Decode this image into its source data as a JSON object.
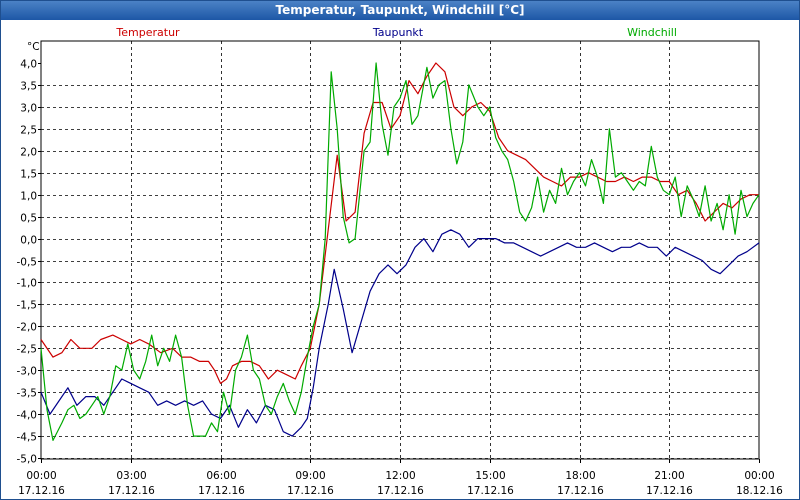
{
  "window": {
    "title": "Temperatur, Taupunkt, Windchill [°C]"
  },
  "chart_data": {
    "type": "line",
    "title": "Temperatur, Taupunkt, Windchill [°C]",
    "ylabel": "°C",
    "ylim": [
      -5.0,
      4.0
    ],
    "y_ticks": [
      "4,0",
      "3,5",
      "3,0",
      "2,5",
      "2,0",
      "1,5",
      "1,0",
      "0,5",
      "0,0",
      "-0,5",
      "-1,0",
      "-1,5",
      "-2,0",
      "-2,5",
      "-3,0",
      "-3,5",
      "-4,0",
      "-4,5",
      "-5,0"
    ],
    "x_range_hours": [
      0,
      24
    ],
    "x_ticks": [
      {
        "time": "00:00",
        "date": "17.12.16"
      },
      {
        "time": "03:00",
        "date": "17.12.16"
      },
      {
        "time": "06:00",
        "date": "17.12.16"
      },
      {
        "time": "09:00",
        "date": "17.12.16"
      },
      {
        "time": "12:00",
        "date": "17.12.16"
      },
      {
        "time": "15:00",
        "date": "17.12.16"
      },
      {
        "time": "18:00",
        "date": "17.12.16"
      },
      {
        "time": "21:00",
        "date": "17.12.16"
      },
      {
        "time": "00:00",
        "date": "18.12.16"
      }
    ],
    "grid": true,
    "legend_position": "top",
    "series": [
      {
        "name": "Temperatur",
        "color": "#cc0000",
        "points": [
          [
            0.0,
            -2.3
          ],
          [
            0.4,
            -2.7
          ],
          [
            0.7,
            -2.6
          ],
          [
            1.0,
            -2.3
          ],
          [
            1.3,
            -2.5
          ],
          [
            1.7,
            -2.5
          ],
          [
            2.0,
            -2.3
          ],
          [
            2.4,
            -2.2
          ],
          [
            2.7,
            -2.3
          ],
          [
            3.0,
            -2.4
          ],
          [
            3.3,
            -2.3
          ],
          [
            3.6,
            -2.4
          ],
          [
            4.0,
            -2.6
          ],
          [
            4.4,
            -2.5
          ],
          [
            4.7,
            -2.7
          ],
          [
            5.0,
            -2.7
          ],
          [
            5.3,
            -2.8
          ],
          [
            5.6,
            -2.8
          ],
          [
            5.8,
            -3.0
          ],
          [
            6.0,
            -3.3
          ],
          [
            6.2,
            -3.2
          ],
          [
            6.4,
            -2.9
          ],
          [
            6.7,
            -2.8
          ],
          [
            7.0,
            -2.8
          ],
          [
            7.3,
            -2.9
          ],
          [
            7.6,
            -3.2
          ],
          [
            7.9,
            -3.0
          ],
          [
            8.2,
            -3.1
          ],
          [
            8.5,
            -3.2
          ],
          [
            8.7,
            -2.9
          ],
          [
            9.0,
            -2.5
          ],
          [
            9.3,
            -1.5
          ],
          [
            9.6,
            0.2
          ],
          [
            9.9,
            1.9
          ],
          [
            10.2,
            0.4
          ],
          [
            10.5,
            0.6
          ],
          [
            10.8,
            2.4
          ],
          [
            11.1,
            3.1
          ],
          [
            11.4,
            3.1
          ],
          [
            11.7,
            2.5
          ],
          [
            12.0,
            2.8
          ],
          [
            12.3,
            3.6
          ],
          [
            12.6,
            3.3
          ],
          [
            12.9,
            3.7
          ],
          [
            13.2,
            4.0
          ],
          [
            13.5,
            3.8
          ],
          [
            13.8,
            3.0
          ],
          [
            14.1,
            2.8
          ],
          [
            14.4,
            3.0
          ],
          [
            14.7,
            3.1
          ],
          [
            15.0,
            2.9
          ],
          [
            15.3,
            2.3
          ],
          [
            15.6,
            2.0
          ],
          [
            15.9,
            1.9
          ],
          [
            16.2,
            1.8
          ],
          [
            16.5,
            1.6
          ],
          [
            16.8,
            1.4
          ],
          [
            17.1,
            1.3
          ],
          [
            17.4,
            1.2
          ],
          [
            17.7,
            1.4
          ],
          [
            18.0,
            1.4
          ],
          [
            18.3,
            1.5
          ],
          [
            18.6,
            1.4
          ],
          [
            18.9,
            1.3
          ],
          [
            19.2,
            1.3
          ],
          [
            19.5,
            1.4
          ],
          [
            19.8,
            1.3
          ],
          [
            20.1,
            1.4
          ],
          [
            20.4,
            1.4
          ],
          [
            20.7,
            1.3
          ],
          [
            21.0,
            1.3
          ],
          [
            21.3,
            1.0
          ],
          [
            21.6,
            1.1
          ],
          [
            21.9,
            0.8
          ],
          [
            22.2,
            0.4
          ],
          [
            22.5,
            0.6
          ],
          [
            22.8,
            0.8
          ],
          [
            23.1,
            0.7
          ],
          [
            23.4,
            0.9
          ],
          [
            23.7,
            1.0
          ],
          [
            24.0,
            1.0
          ]
        ]
      },
      {
        "name": "Taupunkt",
        "color": "#00008b",
        "points": [
          [
            0.0,
            -3.5
          ],
          [
            0.3,
            -4.0
          ],
          [
            0.6,
            -3.7
          ],
          [
            0.9,
            -3.4
          ],
          [
            1.2,
            -3.8
          ],
          [
            1.5,
            -3.6
          ],
          [
            1.8,
            -3.6
          ],
          [
            2.1,
            -3.8
          ],
          [
            2.4,
            -3.5
          ],
          [
            2.7,
            -3.2
          ],
          [
            3.0,
            -3.3
          ],
          [
            3.3,
            -3.4
          ],
          [
            3.6,
            -3.5
          ],
          [
            3.9,
            -3.8
          ],
          [
            4.2,
            -3.7
          ],
          [
            4.5,
            -3.8
          ],
          [
            4.8,
            -3.7
          ],
          [
            5.1,
            -3.8
          ],
          [
            5.4,
            -3.7
          ],
          [
            5.7,
            -4.0
          ],
          [
            6.0,
            -4.1
          ],
          [
            6.3,
            -3.8
          ],
          [
            6.6,
            -4.3
          ],
          [
            6.9,
            -3.9
          ],
          [
            7.2,
            -4.2
          ],
          [
            7.5,
            -3.8
          ],
          [
            7.8,
            -3.9
          ],
          [
            8.1,
            -4.4
          ],
          [
            8.4,
            -4.5
          ],
          [
            8.7,
            -4.3
          ],
          [
            8.9,
            -4.1
          ],
          [
            9.1,
            -3.4
          ],
          [
            9.3,
            -2.5
          ],
          [
            9.6,
            -1.5
          ],
          [
            9.8,
            -0.7
          ],
          [
            10.1,
            -1.6
          ],
          [
            10.4,
            -2.6
          ],
          [
            10.7,
            -1.9
          ],
          [
            11.0,
            -1.2
          ],
          [
            11.3,
            -0.8
          ],
          [
            11.6,
            -0.6
          ],
          [
            11.9,
            -0.8
          ],
          [
            12.2,
            -0.6
          ],
          [
            12.5,
            -0.2
          ],
          [
            12.8,
            0.0
          ],
          [
            13.1,
            -0.3
          ],
          [
            13.4,
            0.1
          ],
          [
            13.7,
            0.2
          ],
          [
            14.0,
            0.1
          ],
          [
            14.3,
            -0.2
          ],
          [
            14.6,
            0.0
          ],
          [
            14.9,
            0.0
          ],
          [
            15.2,
            0.0
          ],
          [
            15.5,
            -0.1
          ],
          [
            15.8,
            -0.1
          ],
          [
            16.1,
            -0.2
          ],
          [
            16.4,
            -0.3
          ],
          [
            16.7,
            -0.4
          ],
          [
            17.0,
            -0.3
          ],
          [
            17.3,
            -0.2
          ],
          [
            17.6,
            -0.1
          ],
          [
            17.9,
            -0.2
          ],
          [
            18.2,
            -0.2
          ],
          [
            18.5,
            -0.1
          ],
          [
            18.8,
            -0.2
          ],
          [
            19.1,
            -0.3
          ],
          [
            19.4,
            -0.2
          ],
          [
            19.7,
            -0.2
          ],
          [
            20.0,
            -0.1
          ],
          [
            20.3,
            -0.2
          ],
          [
            20.6,
            -0.2
          ],
          [
            20.9,
            -0.4
          ],
          [
            21.2,
            -0.2
          ],
          [
            21.5,
            -0.3
          ],
          [
            21.8,
            -0.4
          ],
          [
            22.1,
            -0.5
          ],
          [
            22.4,
            -0.7
          ],
          [
            22.7,
            -0.8
          ],
          [
            23.0,
            -0.6
          ],
          [
            23.3,
            -0.4
          ],
          [
            23.6,
            -0.3
          ],
          [
            24.0,
            -0.1
          ]
        ]
      },
      {
        "name": "Windchill",
        "color": "#00aa00",
        "points": [
          [
            0.0,
            -2.5
          ],
          [
            0.2,
            -3.9
          ],
          [
            0.4,
            -4.6
          ],
          [
            0.7,
            -4.2
          ],
          [
            0.9,
            -3.9
          ],
          [
            1.1,
            -3.8
          ],
          [
            1.3,
            -4.1
          ],
          [
            1.5,
            -4.0
          ],
          [
            1.7,
            -3.8
          ],
          [
            1.9,
            -3.6
          ],
          [
            2.1,
            -4.0
          ],
          [
            2.3,
            -3.6
          ],
          [
            2.5,
            -2.9
          ],
          [
            2.7,
            -3.0
          ],
          [
            2.9,
            -2.4
          ],
          [
            3.1,
            -3.0
          ],
          [
            3.3,
            -3.2
          ],
          [
            3.5,
            -2.8
          ],
          [
            3.7,
            -2.2
          ],
          [
            3.9,
            -2.9
          ],
          [
            4.1,
            -2.5
          ],
          [
            4.3,
            -2.8
          ],
          [
            4.5,
            -2.2
          ],
          [
            4.7,
            -2.7
          ],
          [
            4.9,
            -3.8
          ],
          [
            5.1,
            -4.5
          ],
          [
            5.3,
            -4.5
          ],
          [
            5.5,
            -4.5
          ],
          [
            5.7,
            -4.2
          ],
          [
            5.9,
            -4.4
          ],
          [
            6.1,
            -3.5
          ],
          [
            6.3,
            -4.0
          ],
          [
            6.5,
            -3.0
          ],
          [
            6.7,
            -2.7
          ],
          [
            6.9,
            -2.2
          ],
          [
            7.1,
            -3.0
          ],
          [
            7.3,
            -3.2
          ],
          [
            7.5,
            -3.8
          ],
          [
            7.7,
            -4.0
          ],
          [
            7.9,
            -3.6
          ],
          [
            8.1,
            -3.3
          ],
          [
            8.3,
            -3.7
          ],
          [
            8.5,
            -4.0
          ],
          [
            8.7,
            -3.5
          ],
          [
            8.9,
            -2.7
          ],
          [
            9.1,
            -2.0
          ],
          [
            9.3,
            -1.5
          ],
          [
            9.5,
            0.0
          ],
          [
            9.7,
            3.8
          ],
          [
            9.9,
            2.5
          ],
          [
            10.1,
            0.5
          ],
          [
            10.3,
            -0.1
          ],
          [
            10.5,
            0.0
          ],
          [
            10.8,
            2.0
          ],
          [
            11.0,
            2.2
          ],
          [
            11.2,
            4.0
          ],
          [
            11.4,
            2.6
          ],
          [
            11.6,
            1.9
          ],
          [
            11.8,
            3.0
          ],
          [
            12.0,
            3.2
          ],
          [
            12.2,
            3.6
          ],
          [
            12.4,
            2.6
          ],
          [
            12.6,
            2.8
          ],
          [
            12.9,
            3.9
          ],
          [
            13.1,
            3.2
          ],
          [
            13.3,
            3.5
          ],
          [
            13.5,
            3.6
          ],
          [
            13.7,
            2.5
          ],
          [
            13.9,
            1.7
          ],
          [
            14.1,
            2.2
          ],
          [
            14.3,
            3.5
          ],
          [
            14.6,
            3.0
          ],
          [
            14.8,
            2.8
          ],
          [
            15.0,
            3.0
          ],
          [
            15.2,
            2.3
          ],
          [
            15.4,
            2.0
          ],
          [
            15.6,
            1.8
          ],
          [
            15.8,
            1.3
          ],
          [
            16.0,
            0.6
          ],
          [
            16.2,
            0.4
          ],
          [
            16.4,
            0.7
          ],
          [
            16.6,
            1.4
          ],
          [
            16.8,
            0.6
          ],
          [
            17.0,
            1.1
          ],
          [
            17.2,
            0.8
          ],
          [
            17.4,
            1.6
          ],
          [
            17.6,
            1.0
          ],
          [
            17.8,
            1.3
          ],
          [
            18.0,
            1.5
          ],
          [
            18.2,
            1.2
          ],
          [
            18.4,
            1.8
          ],
          [
            18.6,
            1.4
          ],
          [
            18.8,
            0.8
          ],
          [
            19.0,
            2.5
          ],
          [
            19.2,
            1.4
          ],
          [
            19.4,
            1.5
          ],
          [
            19.6,
            1.3
          ],
          [
            19.8,
            1.1
          ],
          [
            20.0,
            1.3
          ],
          [
            20.2,
            1.2
          ],
          [
            20.4,
            2.1
          ],
          [
            20.6,
            1.4
          ],
          [
            20.8,
            1.1
          ],
          [
            21.0,
            1.0
          ],
          [
            21.2,
            1.4
          ],
          [
            21.4,
            0.5
          ],
          [
            21.6,
            1.2
          ],
          [
            21.8,
            0.9
          ],
          [
            22.0,
            0.5
          ],
          [
            22.2,
            1.2
          ],
          [
            22.4,
            0.4
          ],
          [
            22.6,
            0.8
          ],
          [
            22.8,
            0.2
          ],
          [
            23.0,
            1.0
          ],
          [
            23.2,
            0.1
          ],
          [
            23.4,
            1.1
          ],
          [
            23.6,
            0.5
          ],
          [
            23.8,
            0.8
          ],
          [
            24.0,
            1.0
          ]
        ]
      }
    ]
  }
}
